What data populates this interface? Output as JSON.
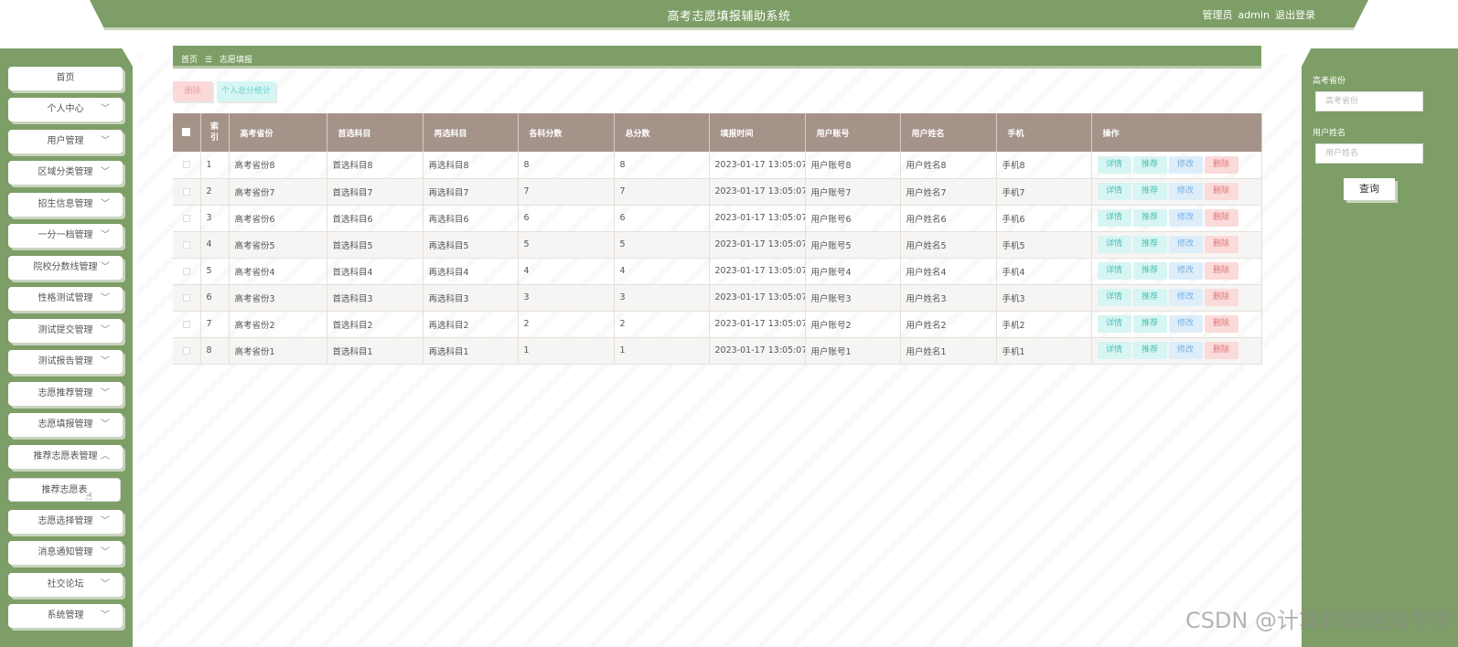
{
  "header": {
    "title": "高考志愿填报辅助系统",
    "user_role": "管理员",
    "user_name": "admin",
    "logout": "退出登录"
  },
  "sidebar": {
    "items": [
      {
        "label": "首页",
        "chevron": ""
      },
      {
        "label": "个人中心",
        "chevron": "﹀"
      },
      {
        "label": "用户管理",
        "chevron": "﹀"
      },
      {
        "label": "区域分类管理",
        "chevron": "﹀"
      },
      {
        "label": "招生信息管理",
        "chevron": "﹀"
      },
      {
        "label": "一分一档管理",
        "chevron": "﹀"
      },
      {
        "label": "院校分数线管理",
        "chevron": "﹀"
      },
      {
        "label": "性格测试管理",
        "chevron": "﹀"
      },
      {
        "label": "测试提交管理",
        "chevron": "﹀"
      },
      {
        "label": "测试报告管理",
        "chevron": "﹀"
      },
      {
        "label": "志愿推荐管理",
        "chevron": "﹀"
      },
      {
        "label": "志愿填报管理",
        "chevron": "﹀"
      },
      {
        "label": "推荐志愿表管理",
        "chevron": "︿"
      },
      {
        "label": "推荐志愿表",
        "chevron": ""
      },
      {
        "label": "志愿选择管理",
        "chevron": "﹀"
      },
      {
        "label": "消息通知管理",
        "chevron": "﹀"
      },
      {
        "label": "社交论坛",
        "chevron": "﹀"
      },
      {
        "label": "系统管理",
        "chevron": "﹀"
      }
    ]
  },
  "breadcrumb": {
    "home": "首页",
    "sep": "☰",
    "current": "志愿填报"
  },
  "actions": {
    "delete": "删除",
    "stats": "个人总分统计"
  },
  "table": {
    "headers": [
      "索引",
      "高考省份",
      "首选科目",
      "再选科目",
      "各科分数",
      "总分数",
      "填报时间",
      "用户账号",
      "用户姓名",
      "手机",
      "操作"
    ],
    "index_header_top": "索",
    "index_header_bottom": "引",
    "rows": [
      [
        "1",
        "高考省份8",
        "首选科目8",
        "再选科目8",
        "8",
        "8",
        "2023-01-17 13:05:07",
        "用户账号8",
        "用户姓名8",
        "手机8"
      ],
      [
        "2",
        "高考省份7",
        "首选科目7",
        "再选科目7",
        "7",
        "7",
        "2023-01-17 13:05:07",
        "用户账号7",
        "用户姓名7",
        "手机7"
      ],
      [
        "3",
        "高考省份6",
        "首选科目6",
        "再选科目6",
        "6",
        "6",
        "2023-01-17 13:05:07",
        "用户账号6",
        "用户姓名6",
        "手机6"
      ],
      [
        "4",
        "高考省份5",
        "首选科目5",
        "再选科目5",
        "5",
        "5",
        "2023-01-17 13:05:07",
        "用户账号5",
        "用户姓名5",
        "手机5"
      ],
      [
        "5",
        "高考省份4",
        "首选科目4",
        "再选科目4",
        "4",
        "4",
        "2023-01-17 13:05:07",
        "用户账号4",
        "用户姓名4",
        "手机4"
      ],
      [
        "6",
        "高考省份3",
        "首选科目3",
        "再选科目3",
        "3",
        "3",
        "2023-01-17 13:05:07",
        "用户账号3",
        "用户姓名3",
        "手机3"
      ],
      [
        "7",
        "高考省份2",
        "首选科目2",
        "再选科目2",
        "2",
        "2",
        "2023-01-17 13:05:07",
        "用户账号2",
        "用户姓名2",
        "手机2"
      ],
      [
        "8",
        "高考省份1",
        "首选科目1",
        "再选科目1",
        "1",
        "1",
        "2023-01-17 13:05:07",
        "用户账号1",
        "用户姓名1",
        "手机1"
      ]
    ],
    "ops": [
      "详情",
      "推荐",
      "修改",
      "删除"
    ]
  },
  "search": {
    "province_label": "高考省份",
    "province_placeholder": "高考省份",
    "name_label": "用户姓名",
    "name_placeholder": "用户姓名",
    "query_button": "查询"
  },
  "watermark": "CSDN @计算机编程指导师",
  "colors": {
    "brand_green": "#7d9e66",
    "table_header": "#a5938a"
  }
}
